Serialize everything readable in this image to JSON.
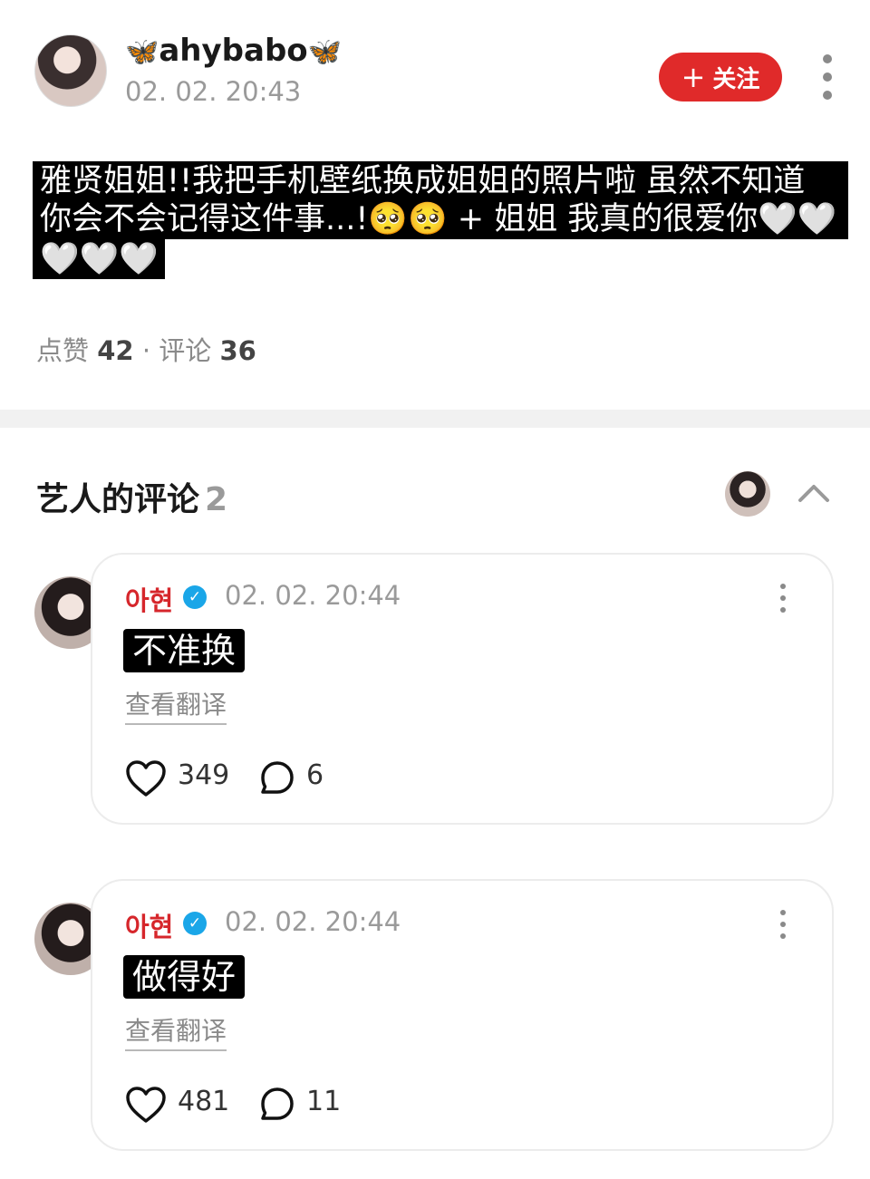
{
  "post": {
    "username": "ahybabo",
    "username_emoji": "🦋",
    "timestamp": "02. 02. 20:43",
    "follow_label": "关注",
    "caption_line1": "雅贤姐姐!!我把手机壁纸换成姐姐的照片啦 虽然不知道",
    "caption_line2": "你会不会记得这件事...!🥺🥺 + 姐姐 我真的很爱你🤍🤍",
    "caption_line3": "🤍🤍🤍",
    "likes_label": "点赞",
    "likes_count": "42",
    "comments_label": "评论",
    "comments_count": "36",
    "stats_separator": "·"
  },
  "artist_comments": {
    "title": "艺人的评论",
    "count": "2"
  },
  "comments": [
    {
      "name": "아현",
      "timestamp": "02. 02. 20:44",
      "text": "不准换",
      "translate_label": "查看翻译",
      "likes": "349",
      "replies": "6"
    },
    {
      "name": "아현",
      "timestamp": "02. 02. 20:44",
      "text": "做得好",
      "translate_label": "查看翻译",
      "likes": "481",
      "replies": "11"
    }
  ],
  "colors": {
    "follow_button": "#e02a2a",
    "artist_name": "#d6262b",
    "verified_badge": "#1aa6e8"
  },
  "icons": {
    "butterfly": "butterfly-icon",
    "more": "more-vertical-icon",
    "verified": "verified-badge-icon",
    "like": "heart-outline-icon",
    "reply": "speech-bubble-icon",
    "collapse": "chevron-up-icon"
  }
}
